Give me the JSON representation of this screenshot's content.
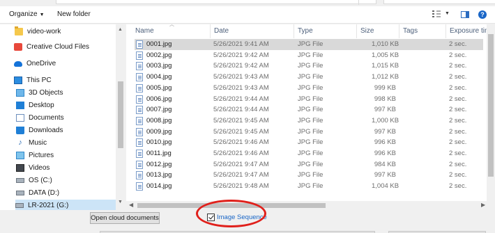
{
  "toolbar": {
    "organize": "Organize",
    "new_folder": "New folder"
  },
  "nav": {
    "items": [
      {
        "label": "video-work",
        "icon": "folder-icon"
      },
      {
        "label": "Creative Cloud Files",
        "icon": "creative-cloud-icon"
      },
      {
        "label": "OneDrive",
        "icon": "onedrive-icon"
      },
      {
        "label": "This PC",
        "icon": "computer-icon"
      },
      {
        "label": "3D Objects",
        "icon": "3d-objects-icon"
      },
      {
        "label": "Desktop",
        "icon": "desktop-icon"
      },
      {
        "label": "Documents",
        "icon": "documents-icon"
      },
      {
        "label": "Downloads",
        "icon": "downloads-icon"
      },
      {
        "label": "Music",
        "icon": "music-icon"
      },
      {
        "label": "Pictures",
        "icon": "pictures-icon"
      },
      {
        "label": "Videos",
        "icon": "videos-icon"
      },
      {
        "label": "OS (C:)",
        "icon": "drive-icon"
      },
      {
        "label": "DATA (D:)",
        "icon": "drive-icon"
      },
      {
        "label": "LR-2021 (G:)",
        "icon": "drive-icon"
      }
    ]
  },
  "columns": [
    "Name",
    "Date",
    "Type",
    "Size",
    "Tags",
    "Exposure time"
  ],
  "files": [
    {
      "name": "0001.jpg",
      "date": "5/26/2021 9:41 AM",
      "type": "JPG File",
      "size": "1,010 KB",
      "exposure": "2 sec."
    },
    {
      "name": "0002.jpg",
      "date": "5/26/2021 9:42 AM",
      "type": "JPG File",
      "size": "1,005 KB",
      "exposure": "2 sec."
    },
    {
      "name": "0003.jpg",
      "date": "5/26/2021 9:42 AM",
      "type": "JPG File",
      "size": "1,015 KB",
      "exposure": "2 sec."
    },
    {
      "name": "0004.jpg",
      "date": "5/26/2021 9:43 AM",
      "type": "JPG File",
      "size": "1,012 KB",
      "exposure": "2 sec."
    },
    {
      "name": "0005.jpg",
      "date": "5/26/2021 9:43 AM",
      "type": "JPG File",
      "size": "999 KB",
      "exposure": "2 sec."
    },
    {
      "name": "0006.jpg",
      "date": "5/26/2021 9:44 AM",
      "type": "JPG File",
      "size": "998 KB",
      "exposure": "2 sec."
    },
    {
      "name": "0007.jpg",
      "date": "5/26/2021 9:44 AM",
      "type": "JPG File",
      "size": "997 KB",
      "exposure": "2 sec."
    },
    {
      "name": "0008.jpg",
      "date": "5/26/2021 9:45 AM",
      "type": "JPG File",
      "size": "1,000 KB",
      "exposure": "2 sec."
    },
    {
      "name": "0009.jpg",
      "date": "5/26/2021 9:45 AM",
      "type": "JPG File",
      "size": "997 KB",
      "exposure": "2 sec."
    },
    {
      "name": "0010.jpg",
      "date": "5/26/2021 9:46 AM",
      "type": "JPG File",
      "size": "996 KB",
      "exposure": "2 sec."
    },
    {
      "name": "0011.jpg",
      "date": "5/26/2021 9:46 AM",
      "type": "JPG File",
      "size": "996 KB",
      "exposure": "2 sec."
    },
    {
      "name": "0012.jpg",
      "date": "5/26/2021 9:47 AM",
      "type": "JPG File",
      "size": "984 KB",
      "exposure": "2 sec."
    },
    {
      "name": "0013.jpg",
      "date": "5/26/2021 9:47 AM",
      "type": "JPG File",
      "size": "997 KB",
      "exposure": "2 sec."
    },
    {
      "name": "0014.jpg",
      "date": "5/26/2021 9:48 AM",
      "type": "JPG File",
      "size": "1,004 KB",
      "exposure": "2 sec."
    }
  ],
  "bottom": {
    "open_cloud": "Open cloud documents",
    "image_sequence": "Image Sequence"
  },
  "colors": {
    "highlight_ellipse": "#e0201b",
    "selection": "#d9d9d9",
    "link_blue": "#1a66c7"
  }
}
